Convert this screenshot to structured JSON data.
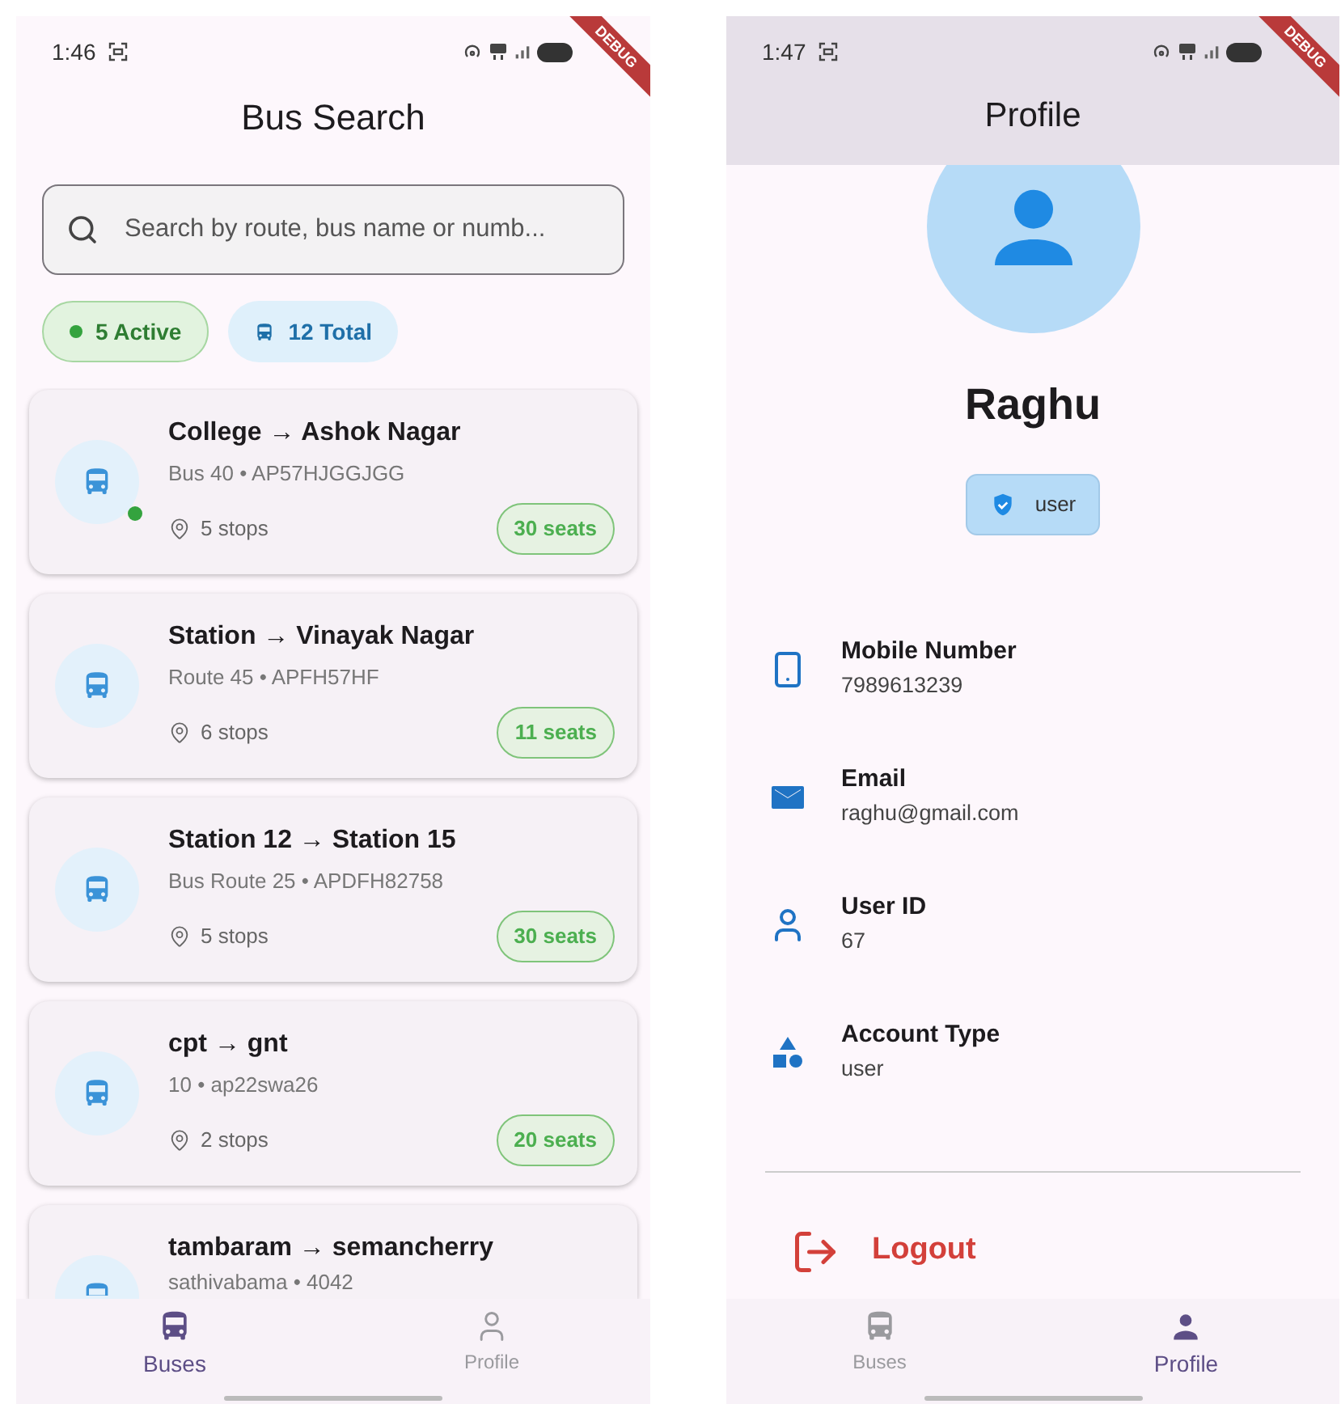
{
  "bus_search": {
    "status_bar": {
      "time": "1:46",
      "banner": "DEBUG"
    },
    "title": "Bus Search",
    "search": {
      "placeholder": "Search by route, bus name or numb..."
    },
    "chips": [
      {
        "kind": "active",
        "label": "5 Active"
      },
      {
        "kind": "total",
        "label": "12 Total"
      }
    ],
    "buses": [
      {
        "route": "College → Ashok Nagar",
        "details": "Bus 40 • AP57HJGGJGG",
        "active": true,
        "stops": "5 stops",
        "seats": "30 seats"
      },
      {
        "route": "Station → Vinayak Nagar",
        "details": "Route 45 • APFH57HF",
        "active": false,
        "stops": "6 stops",
        "seats": "11 seats"
      },
      {
        "route": "Station 12 → Station 15",
        "details": "Bus Route 25 • APDFH82758",
        "active": false,
        "stops": "5 stops",
        "seats": "30 seats"
      },
      {
        "route": "cpt → gnt",
        "details": "10 • ap22swa26",
        "active": false,
        "stops": "2 stops",
        "seats": "20 seats"
      },
      {
        "route": "tambaram → semancherry",
        "details": "sathivabama • 4042"
      }
    ],
    "nav": [
      {
        "kind": "buses",
        "label": "Buses",
        "selected": true
      },
      {
        "kind": "profile",
        "label": "Profile",
        "selected": false
      }
    ]
  },
  "profile": {
    "status_bar": {
      "time": "1:47",
      "banner": "DEBUG"
    },
    "title": "Profile",
    "name": "Raghu",
    "role_badge": "user",
    "info": [
      {
        "kind": "phone",
        "label": "Mobile Number",
        "value": "7989613239"
      },
      {
        "kind": "email",
        "label": "Email",
        "value": "raghu@gmail.com"
      },
      {
        "kind": "id",
        "label": "User ID",
        "value": "67"
      },
      {
        "kind": "type",
        "label": "Account Type",
        "value": "user"
      }
    ],
    "logout": "Logout",
    "nav": [
      {
        "kind": "buses",
        "label": "Buses",
        "selected": false
      },
      {
        "kind": "profile",
        "label": "Profile",
        "selected": true
      }
    ]
  }
}
